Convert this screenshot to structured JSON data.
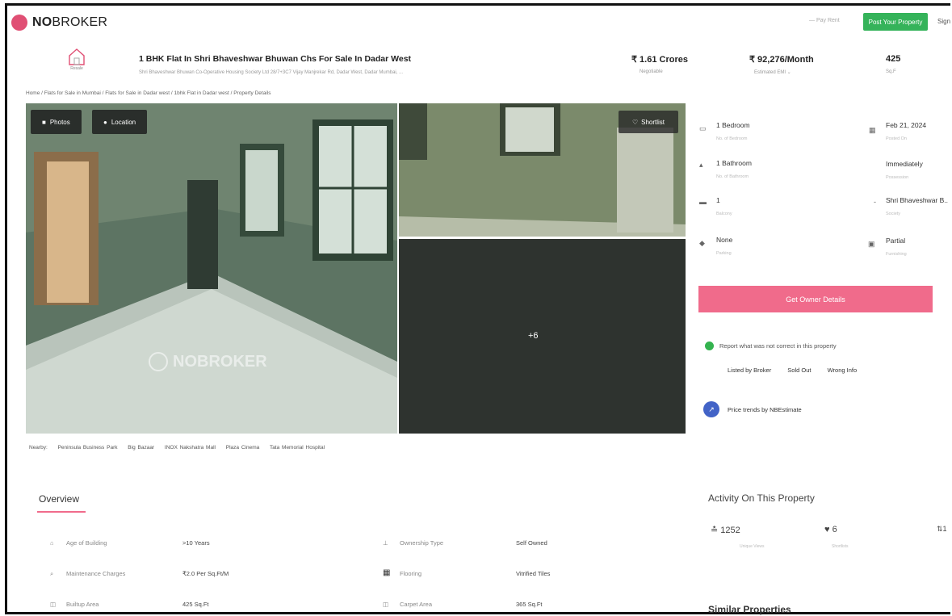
{
  "header": {
    "logo_bold": "NO",
    "logo_light": "BROKER",
    "menu": "— Pay Rent",
    "post_button": "Post Your Property",
    "signin": "Sign"
  },
  "listing": {
    "icon_caption": "Resale",
    "title": "1 BHK Flat In Shri Bhaveshwar Bhuwan Chs For Sale In Dadar West",
    "address": "Shri Bhaveshwar Bhuwan Co-Operative Housing Society Ltd 28/7+3C7 Vijay Manjrekar Rd, Dadar West, Dadar Mumbai, ...",
    "price": "₹ 1.61 Crores",
    "price_sub": "Negotiable",
    "emi": "₹ 92,276/Month",
    "emi_sub": "Estimated EMI ⌄",
    "area": "425",
    "area_sub": "Sq.F"
  },
  "breadcrumb": "Home / Flats for Sale in Mumbai / Flats for Sale in Dadar west / 1bhk Flat in Dadar west / Property Details",
  "photos": {
    "photos_button": "Photos",
    "location_button": "Location",
    "shortlist_button": "Shortlist",
    "more_count": "+6",
    "watermark": "NOBROKER"
  },
  "nearby": {
    "label": "Nearby:",
    "places": [
      "Peninsula Business Park",
      "Big Bazaar",
      "INOX Nakshatra Mall",
      "Plaza Cinema",
      "Tata Memorial Hospital"
    ]
  },
  "details": {
    "bedroom": "1 Bedroom",
    "bedroom_sub": "No. of Bedroom",
    "date": "Feb 21, 2024",
    "date_sub": "Posted On",
    "bathroom": "1 Bathroom",
    "bathroom_sub": "No. of Bathroom",
    "possession": "Immediately",
    "possession_sub": "Possession",
    "balcony": "1",
    "balcony_sub": "Balcony",
    "society": "Shri Bhaveshwar B..",
    "society_sub": "Society",
    "parking": "None",
    "parking_sub": "Parking",
    "furnishing": "Partial",
    "furnishing_sub": "Furnishing"
  },
  "owner_button": "Get Owner Details",
  "report": {
    "text": "Report what was not correct in this property",
    "links": [
      "Listed by Broker",
      "Sold Out",
      "Wrong Info"
    ]
  },
  "trends": "Price trends by NBEstimate",
  "overview": {
    "heading": "Overview",
    "rows": [
      {
        "label": "Age of Building",
        "value": ">10 Years"
      },
      {
        "label": "Ownership Type",
        "value": "Self Owned"
      },
      {
        "label": "Maintenance Charges",
        "value": "₹2.0 Per Sq.Ft/M"
      },
      {
        "label": "Flooring",
        "value": "Vitrified Tiles"
      },
      {
        "label": "Builtup Area",
        "value": "425 Sq.Ft"
      },
      {
        "label": "Carpet Area",
        "value": "365 Sq.Ft"
      }
    ]
  },
  "activity": {
    "heading": "Activity On This Property",
    "views": "1252",
    "views_sub": "Unique Views",
    "shortlists": "6",
    "shortlists_sub": "Shortlists",
    "contacts": "1"
  },
  "similar_heading": "Similar Properties",
  "colors": {
    "accent": "#f06b8b",
    "green": "#35b35a",
    "blue": "#4263c7"
  }
}
